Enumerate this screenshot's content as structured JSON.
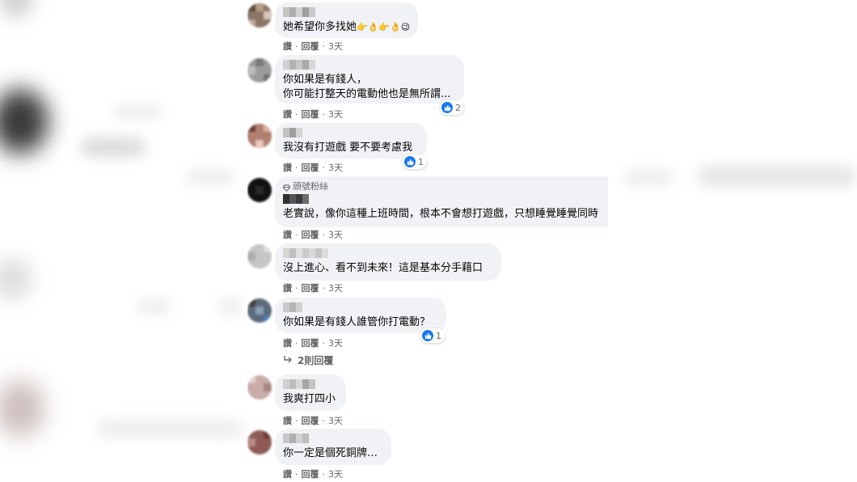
{
  "actions": {
    "like": "讚",
    "reply": "回覆",
    "sep": "·"
  },
  "badge_label": "頭號粉絲",
  "comments": [
    {
      "text_lines": [
        "她希望你多找她"
      ],
      "emoji": "👉👌👉👌😉",
      "time": "3天"
    },
    {
      "text_lines": [
        "你如果是有錢人，",
        "你可能打整天的電動他也是無所謂..."
      ],
      "time": "3天",
      "likes": "2"
    },
    {
      "text_lines": [
        "我沒有打遊戲 要不要考慮我"
      ],
      "time": "3天",
      "likes": "1"
    },
    {
      "text_lines": [
        "老實說，像你這種上班時間，根本不會想打遊戲，只想睡覺睡覺同時"
      ],
      "time": "3天"
    },
    {
      "text_lines": [
        "沒上進心、看不到未來！這是基本分手藉口"
      ],
      "time": "3天"
    },
    {
      "text_lines": [
        "你如果是有錢人誰管你打電動？"
      ],
      "time": "3天",
      "likes": "1"
    },
    {
      "text_lines": [
        "我爽打四小"
      ],
      "time": "3天"
    },
    {
      "text_lines": [
        "你一定是個死銅牌…"
      ],
      "time": "3天"
    }
  ],
  "replies_link": "2則回覆",
  "colors": {
    "bubble": "#f0f2f5",
    "like_blue": "#1877f2",
    "meta_gray": "#65676b"
  }
}
